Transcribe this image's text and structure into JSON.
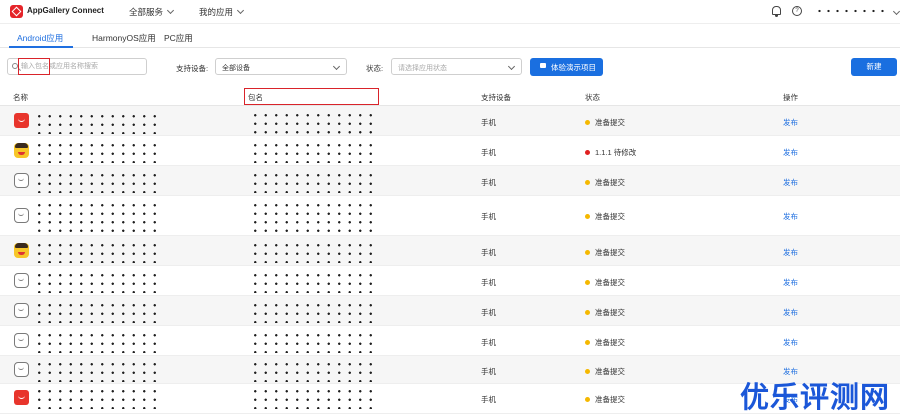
{
  "header": {
    "brand": "AppGallery Connect",
    "nav": [
      {
        "label": "全部服务"
      },
      {
        "label": "我的应用"
      }
    ]
  },
  "tabs": [
    {
      "label": "Android应用",
      "active": true
    },
    {
      "label": "HarmonyOS应用",
      "active": false
    },
    {
      "label": "PC应用",
      "active": false
    }
  ],
  "filters": {
    "search_placeholder": "输入包名或应用名称搜索",
    "device_label": "支持设备:",
    "device_value": "全部设备",
    "status_label": "状态:",
    "status_placeholder": "请选择应用状态",
    "demo_button": "体验演示项目",
    "new_button": "新建"
  },
  "table": {
    "columns": [
      "名称",
      "包名",
      "支持设备",
      "状态",
      "操作"
    ],
    "rows": [
      {
        "icon": "red-app-icon",
        "device": "手机",
        "status": "准备提交",
        "status_color": "#f5b800",
        "action": "发布"
      },
      {
        "icon": "face-app-icon",
        "device": "手机",
        "status": "1.1.1 待修改",
        "status_color": "#e02020",
        "action": "发布"
      },
      {
        "icon": "outline-app-icon",
        "device": "手机",
        "status": "准备提交",
        "status_color": "#f5b800",
        "action": "发布"
      },
      {
        "icon": "outline-app-icon",
        "device": "手机",
        "status": "准备提交",
        "status_color": "#f5b800",
        "action": "发布"
      },
      {
        "icon": "face-app-icon",
        "device": "手机",
        "status": "准备提交",
        "status_color": "#f5b800",
        "action": "发布"
      },
      {
        "icon": "outline-app-icon",
        "device": "手机",
        "status": "准备提交",
        "status_color": "#f5b800",
        "action": "发布"
      },
      {
        "icon": "outline-app-icon",
        "device": "手机",
        "status": "准备提交",
        "status_color": "#f5b800",
        "action": "发布"
      },
      {
        "icon": "outline-app-icon",
        "device": "手机",
        "status": "准备提交",
        "status_color": "#f5b800",
        "action": "发布"
      },
      {
        "icon": "outline-app-icon",
        "device": "手机",
        "status": "准备提交",
        "status_color": "#f5b800",
        "action": "发布"
      },
      {
        "icon": "red-app-icon",
        "device": "手机",
        "status": "准备提交",
        "status_color": "#f5b800",
        "action": "发布"
      }
    ]
  },
  "colors": {
    "accent": "#1f6fe0",
    "highlight_box": "#d9232a"
  },
  "watermark": "优乐评测网"
}
